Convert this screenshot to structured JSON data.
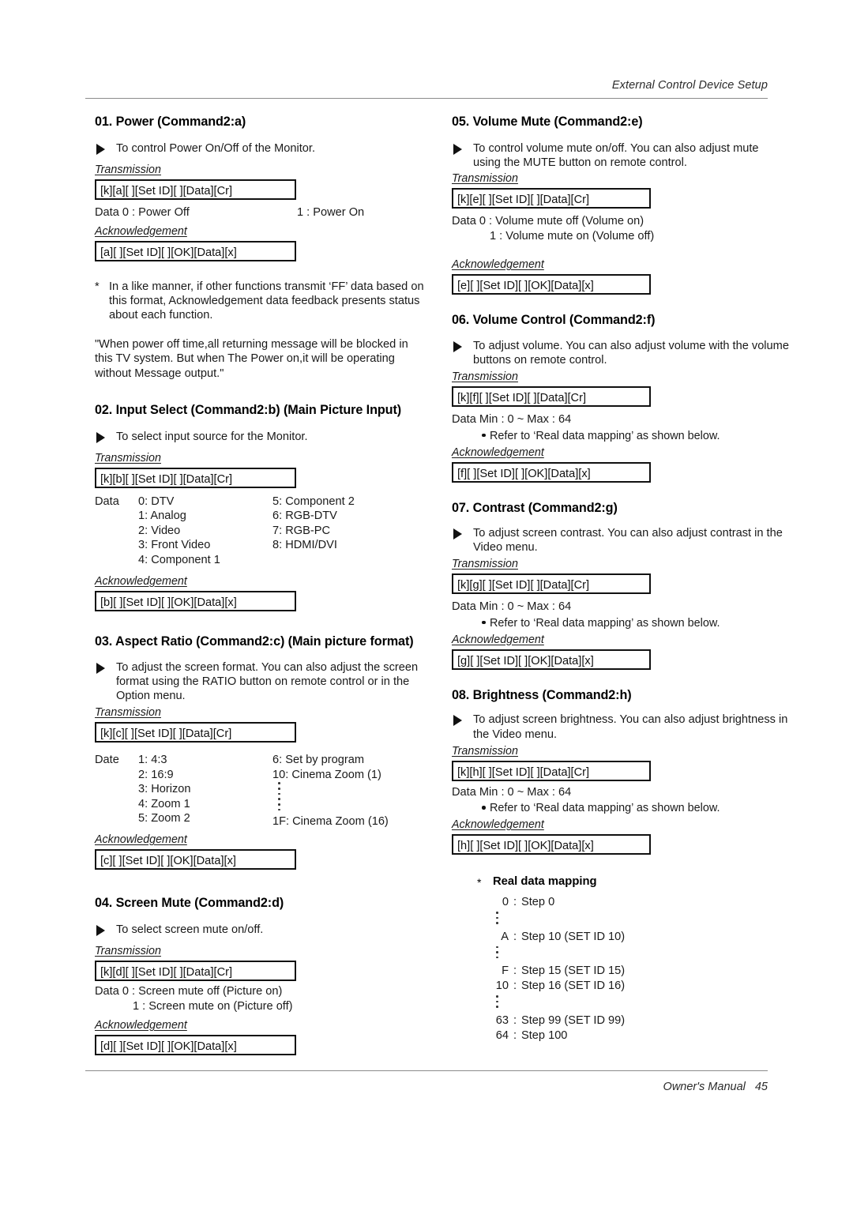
{
  "header": {
    "title": "External Control Device Setup"
  },
  "footer": {
    "manual_label": "Owner's Manual",
    "page_number": "45"
  },
  "labels": {
    "transmission": "Transmission",
    "acknowledgement": "Acknowledgement",
    "data": "Data",
    "date": "Date",
    "refer_note": "Refer to ‘Real data mapping’ as shown below.",
    "range": "Min : 0 ~ Max : 64"
  },
  "sections": {
    "s01": {
      "title": "01. Power (Command2:a)",
      "desc": "To control Power On/Off of the Monitor.",
      "transmission": "[k][a][  ][Set ID][  ][Data][Cr]",
      "data_left": "Data  0  :  Power Off",
      "data_right": "1  :  Power On",
      "acknowledgement": "[a][  ][Set ID][  ][OK][Data][x]",
      "note1": "In a like manner, if other functions transmit ‘FF’ data based on this format, Acknowledgement data feedback presents status about each function.",
      "note2": "\"When power off time,all returning message will be blocked in this TV system. But when The Power on,it will be operating without Message output.\""
    },
    "s02": {
      "title": "02. Input Select (Command2:b) (Main Picture Input)",
      "desc": "To select input source for the Monitor.",
      "transmission": "[k][b][  ][Set ID][  ][Data][Cr]",
      "data_label": "Data",
      "col1": [
        "0: DTV",
        "1: Analog",
        "2: Video",
        "3: Front Video",
        "4: Component 1"
      ],
      "col2": [
        "5: Component 2",
        "6: RGB-DTV",
        "7: RGB-PC",
        "8: HDMI/DVI"
      ],
      "acknowledgement": "[b][  ][Set ID][  ][OK][Data][x]"
    },
    "s03": {
      "title": "03. Aspect Ratio (Command2:c) (Main picture format)",
      "desc": "To adjust the screen format. You can also adjust the screen format using the RATIO button on remote control or in the Option menu.",
      "transmission": "[k][c][  ][Set ID][  ][Data][Cr]",
      "data_label": "Date",
      "col1": [
        "1: 4:3",
        "2: 16:9",
        "3: Horizon",
        "4: Zoom 1",
        "5: Zoom 2"
      ],
      "col2_top": [
        "6: Set by program",
        "10: Cinema Zoom (1)"
      ],
      "col2_bottom": [
        "1F: Cinema Zoom (16)"
      ],
      "acknowledgement": "[c][  ][Set ID][  ][OK][Data][x]"
    },
    "s04": {
      "title": "04. Screen Mute (Command2:d)",
      "desc": "To select screen mute on/off.",
      "transmission": "[k][d][  ][Set ID][  ][Data][Cr]",
      "data_line1": "Data  0  :  Screen mute off (Picture on)",
      "data_line2": "1  :  Screen mute on (Picture off)",
      "acknowledgement": "[d][  ][Set ID][  ][OK][Data][x]"
    },
    "s05": {
      "title": "05. Volume Mute (Command2:e)",
      "desc": "To control volume mute on/off. You can also adjust mute using the MUTE button on remote control.",
      "transmission": "[k][e][  ][Set ID][  ][Data][Cr]",
      "data_line1": "Data  0  :  Volume mute off (Volume on)",
      "data_line2": "1  :  Volume mute on (Volume off)",
      "acknowledgement": "[e][  ][Set ID][  ][OK][Data][x]"
    },
    "s06": {
      "title": "06. Volume Control (Command2:f)",
      "desc": "To adjust volume. You can also adjust volume with the volume buttons on remote control.",
      "transmission": "[k][f][  ][Set ID][  ][Data][Cr]",
      "data_range": "Data   Min : 0 ~ Max : 64",
      "refer": "Refer to ‘Real data mapping’ as shown below.",
      "acknowledgement": "[f][  ][Set ID][  ][OK][Data][x]"
    },
    "s07": {
      "title": "07. Contrast (Command2:g)",
      "desc": "To adjust screen contrast. You can also adjust contrast in the Video menu.",
      "transmission": "[k][g][  ][Set ID][  ][Data][Cr]",
      "data_range": "Data   Min : 0 ~ Max : 64",
      "refer": "Refer to ‘Real data mapping’ as shown below.",
      "acknowledgement": "[g][  ][Set ID][  ][OK][Data][x]"
    },
    "s08": {
      "title": "08. Brightness (Command2:h)",
      "desc": "To adjust screen brightness. You can also adjust brightness in the Video menu.",
      "transmission": "[k][h][  ][Set ID][  ][Data][Cr]",
      "data_range": "Data   Min : 0 ~ Max : 64",
      "refer": "Refer to ‘Real data mapping’ as shown below.",
      "acknowledgement": "[h][  ][Set ID][  ][OK][Data][x]"
    }
  },
  "real_data_mapping": {
    "title": "Real data mapping",
    "star": "*",
    "rows": [
      {
        "key": "0",
        "value": "Step 0"
      },
      {
        "key": "A",
        "value": "Step 10 (SET ID 10)"
      },
      {
        "key": "F",
        "value": "Step 15 (SET ID 15)"
      },
      {
        "key": "10",
        "value": "Step 16 (SET ID 16)"
      },
      {
        "key": "63",
        "value": "Step 99 (SET ID 99)"
      },
      {
        "key": "64",
        "value": "Step 100"
      }
    ]
  }
}
